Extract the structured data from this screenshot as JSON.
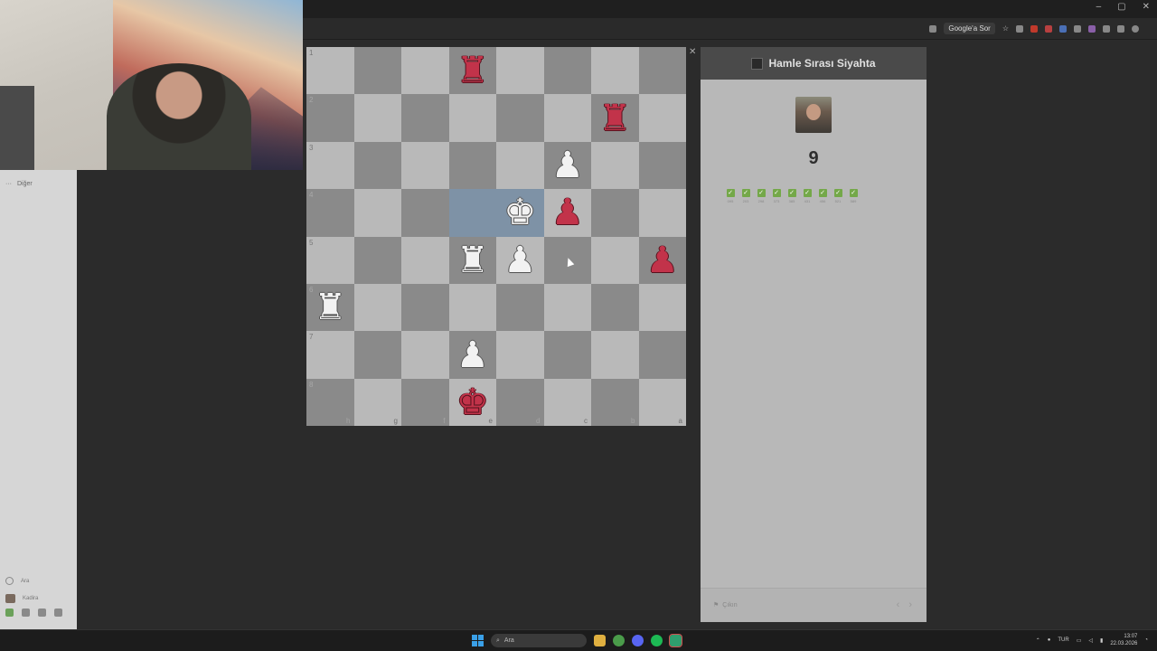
{
  "browser": {
    "google_button": "Google'a Sor",
    "window_controls": [
      "–",
      "▢",
      "✕"
    ]
  },
  "sidebar": {
    "top_label": "Diğer",
    "bottom_items": [
      {
        "icon": "search-icon",
        "label": "Ara"
      },
      {
        "icon": "avatar",
        "label": "Kadira"
      }
    ]
  },
  "board": {
    "ranks": [
      "1",
      "2",
      "3",
      "4",
      "5",
      "6",
      "7",
      "8"
    ],
    "files": [
      "h",
      "g",
      "f",
      "e",
      "d",
      "c",
      "b",
      "a"
    ],
    "highlighted": [
      "3-3",
      "3-4"
    ],
    "pieces": [
      {
        "row": 0,
        "col": 3,
        "glyph": "♜",
        "color": "red"
      },
      {
        "row": 1,
        "col": 6,
        "glyph": "♜",
        "color": "red"
      },
      {
        "row": 2,
        "col": 5,
        "glyph": "♟",
        "color": "white"
      },
      {
        "row": 3,
        "col": 4,
        "glyph": "♚",
        "color": "white"
      },
      {
        "row": 3,
        "col": 5,
        "glyph": "♟",
        "color": "red"
      },
      {
        "row": 4,
        "col": 3,
        "glyph": "♜",
        "color": "white"
      },
      {
        "row": 4,
        "col": 4,
        "glyph": "♟",
        "color": "white"
      },
      {
        "row": 4,
        "col": 7,
        "glyph": "♟",
        "color": "red"
      },
      {
        "row": 5,
        "col": 0,
        "glyph": "♜",
        "color": "white"
      },
      {
        "row": 6,
        "col": 3,
        "glyph": "♟",
        "color": "white"
      },
      {
        "row": 7,
        "col": 3,
        "glyph": "♚",
        "color": "red"
      }
    ],
    "colors": {
      "light": "#b9b9b9",
      "dark": "#8a8a8a",
      "highlight": "#7e92a6"
    }
  },
  "panel": {
    "title": "Hamle Sırası Siyahta",
    "score": "9",
    "checks": [
      "095",
      "203",
      "298",
      "373",
      "385",
      "431",
      "456",
      "521",
      "589"
    ],
    "exit_label": "Çıkın",
    "prev_icon": "‹",
    "next_icon": "›"
  },
  "taskbar": {
    "search_placeholder": "Ara",
    "language": "TUR",
    "time": "13:07",
    "date": "22.03.2026"
  }
}
